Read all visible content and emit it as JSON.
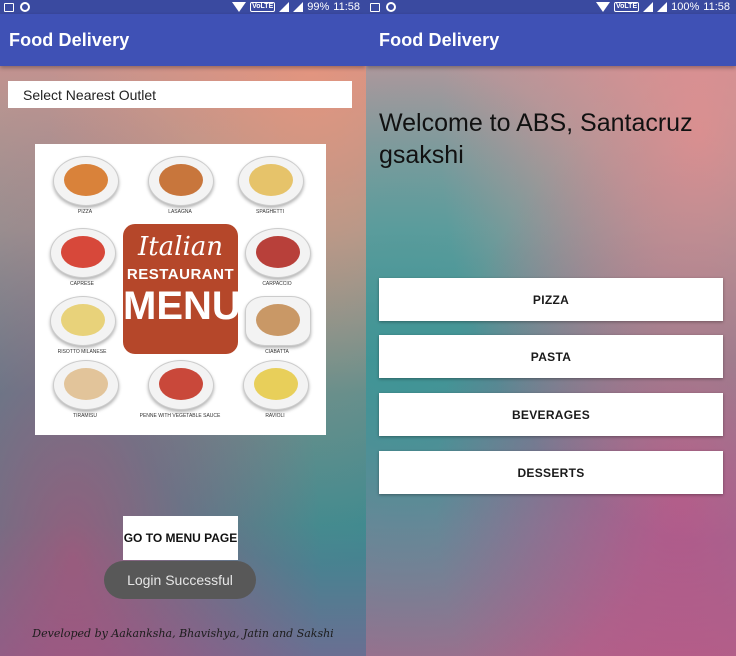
{
  "left_screen": {
    "status_bar": {
      "battery": "99%",
      "time": "11:58",
      "volte": "VoLTE"
    },
    "app_title": "Food Delivery",
    "outlet_spinner": {
      "label": "Select Nearest Outlet"
    },
    "menu_image": {
      "title_line1": "Italian",
      "title_line2": "RESTAURANT",
      "title_line3": "MENU",
      "dishes": [
        "PIZZA",
        "LASAGNA",
        "SPAGHETTI",
        "CAPRESE",
        "CARPACCIO",
        "RISOTTO MILANESE",
        "CIABATTA",
        "TIRAMISU",
        "PENNE WITH VEGETABLE SAUCE",
        "RAVIOLI"
      ]
    },
    "go_button": "GO TO MENU PAGE",
    "toast": "Login Successful",
    "credits": "Developed by Aakanksha, Bhavishya, Jatin and Sakshi"
  },
  "right_screen": {
    "status_bar": {
      "battery": "100%",
      "time": "11:58",
      "volte": "VoLTE"
    },
    "app_title": "Food Delivery",
    "welcome_line1": "Welcome to ABS, Santacruz",
    "welcome_line2": "gsakshi",
    "categories": [
      "PIZZA",
      "PASTA",
      "BEVERAGES",
      "DESSERTS"
    ]
  }
}
